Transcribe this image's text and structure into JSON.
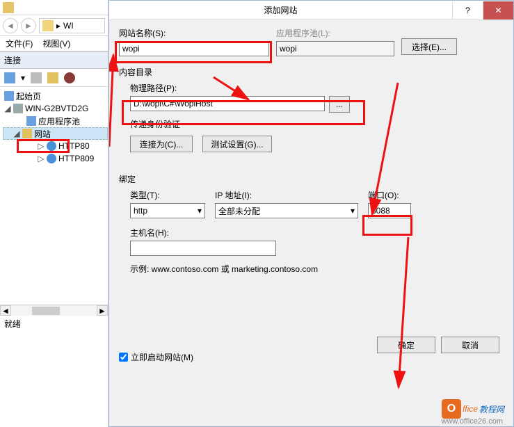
{
  "explorer": {
    "addressbar_text": "WI",
    "menu": {
      "file": "文件(F)",
      "view": "视图(V)"
    },
    "connections_label": "连接",
    "tree": {
      "start_page": "起始页",
      "server": "WIN-G2BVTD2G",
      "app_pools": "应用程序池",
      "sites": "网站",
      "site1": "HTTP80",
      "site2": "HTTP809"
    },
    "ready": "就绪"
  },
  "dialog": {
    "title": "添加网站",
    "help_glyph": "?",
    "close_glyph": "✕",
    "site_name_label": "网站名称(S):",
    "site_name_value": "wopi",
    "app_pool_label": "应用程序池(L):",
    "app_pool_value": "wopi",
    "select_btn": "选择(E)...",
    "content_dir_label": "内容目录",
    "physical_path_label": "物理路径(P):",
    "physical_path_value": "D:\\wopi\\C#\\WopiHost",
    "browse_btn": "...",
    "passthrough_label": "传递身份验证",
    "connect_as_btn": "连接为(C)...",
    "test_settings_btn": "测试设置(G)...",
    "binding_label": "绑定",
    "type_label": "类型(T):",
    "type_value": "http",
    "ip_label": "IP 地址(I):",
    "ip_value": "全部未分配",
    "port_label": "端口(O):",
    "port_value": "8088",
    "host_label": "主机名(H):",
    "host_value": "",
    "example_text": "示例: www.contoso.com 或 marketing.contoso.com",
    "start_site_label": "立即启动网站(M)",
    "ok_btn": "确定",
    "cancel_btn": "取消"
  },
  "watermark": {
    "text1": "ffice",
    "text2": "教程网",
    "sub": "www.office26.com"
  }
}
